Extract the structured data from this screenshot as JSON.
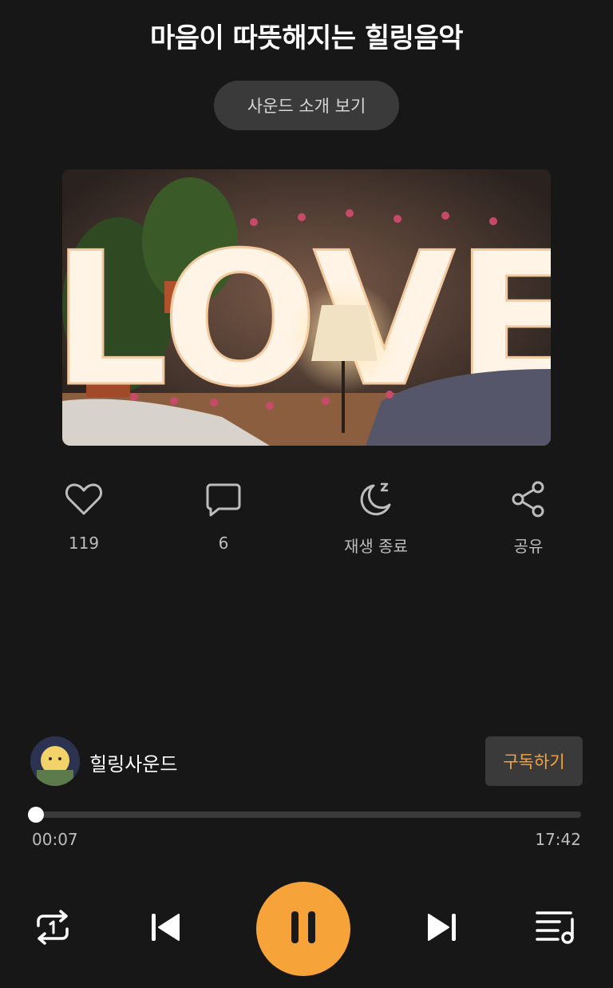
{
  "header": {
    "title": "마음이 따뜻해지는 힐링음악"
  },
  "intro_button": {
    "label": "사운드 소개 보기"
  },
  "cover": {
    "text": "LOVE"
  },
  "actions": {
    "like": {
      "icon": "heart-icon",
      "label": "119"
    },
    "comment": {
      "icon": "comment-icon",
      "label": "6"
    },
    "sleep": {
      "icon": "moon-sleep-icon",
      "label": "재생 종료"
    },
    "share": {
      "icon": "share-icon",
      "label": "공유"
    }
  },
  "channel": {
    "name": "힐링사운드",
    "subscribe_label": "구독하기"
  },
  "player": {
    "current_time": "00:07",
    "total_time": "17:42",
    "progress_fraction": 0.0066,
    "state": "playing"
  },
  "colors": {
    "accent": "#f6a33a",
    "background": "#171717",
    "button_bg": "#3a3a3a"
  }
}
